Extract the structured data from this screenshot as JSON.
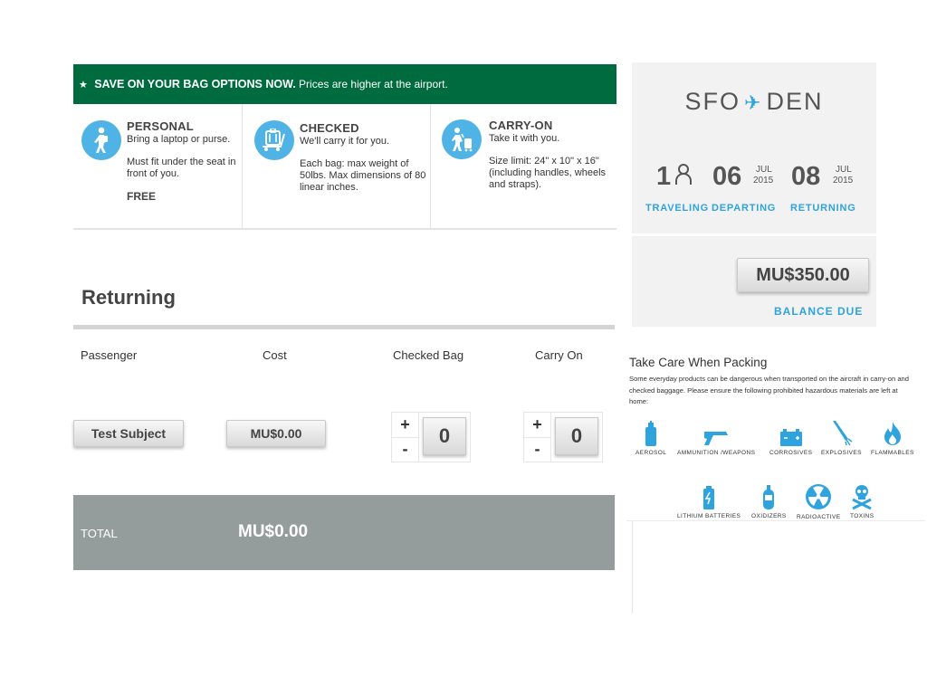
{
  "promo": {
    "bold": "SAVE ON YOUR BAG OPTIONS NOW.",
    "rest": "Prices are higher at the airport."
  },
  "bags": [
    {
      "icon": "walking-person-icon",
      "title": "PERSONAL",
      "subtitle": "Bring a  laptop or purse.",
      "details": "Must fit under the seat in front of you.",
      "price": "FREE"
    },
    {
      "icon": "luggage-cart-icon",
      "title": "CHECKED",
      "subtitle": "We'll carry it for you.",
      "details": "Each bag: max weight of 50lbs. Max dimensions of 80 linear inches.",
      "price": ""
    },
    {
      "icon": "rolling-suitcase-icon",
      "title": "CARRY-ON",
      "subtitle": "Take it with you.",
      "details": "Size limit: 24\" x 10\" x 16\" (including handles, wheels and straps).",
      "price": ""
    }
  ],
  "returning": {
    "title": "Returning",
    "columns": {
      "passenger": "Passenger",
      "cost": "Cost",
      "checked_bag": "Checked Bag",
      "carry_on": "Carry On"
    },
    "rows": [
      {
        "passenger": "Test Subject",
        "cost": "MU$0.00",
        "checked_bag": "0",
        "carry_on": "0"
      }
    ],
    "stepper": {
      "plus": "+",
      "minus": "-"
    },
    "total_label": "TOTAL",
    "total_value": "MU$0.00"
  },
  "trip": {
    "origin": "SFO",
    "destination": "DEN",
    "travelers": "1",
    "depart_day": "06",
    "depart_month": "JUL",
    "depart_year": "2015",
    "return_day": "08",
    "return_month": "JUL",
    "return_year": "2015",
    "label_traveling": "TRAVELING",
    "label_departing": "DEPARTING",
    "label_returning": "RETURNING",
    "balance": "MU$350.00",
    "balance_label": "BALANCE DUE",
    "accent_color": "#2ea3de"
  },
  "packing": {
    "title": "Take Care When Packing",
    "text": "Some everyday products can be dangerous when transported on the aircraft in carry-on and checked baggage. Please ensure the following prohibited hazardous materials are left at home:",
    "hazards": [
      {
        "label": "AEROSOL",
        "icon": "aerosol-can-icon"
      },
      {
        "label": "AMMUNITION /WEAPONS",
        "icon": "gun-icon"
      },
      {
        "label": "CORROSIVES",
        "icon": "car-battery-icon"
      },
      {
        "label": "EXPLOSIVES",
        "icon": "firework-icon"
      },
      {
        "label": "FLAMMABLES",
        "icon": "flame-icon"
      },
      {
        "label": "LITHIUM BATTERIES",
        "icon": "battery-icon"
      },
      {
        "label": "OXIDIZERS",
        "icon": "gas-cylinder-icon"
      },
      {
        "label": "RADIOACTIVE",
        "icon": "radioactive-icon"
      },
      {
        "label": "TOXINS",
        "icon": "skull-crossbones-icon"
      }
    ]
  },
  "colors": {
    "promo_green": "#006b3f",
    "accent_blue": "#2ea3de",
    "total_grey": "#959c9c"
  }
}
